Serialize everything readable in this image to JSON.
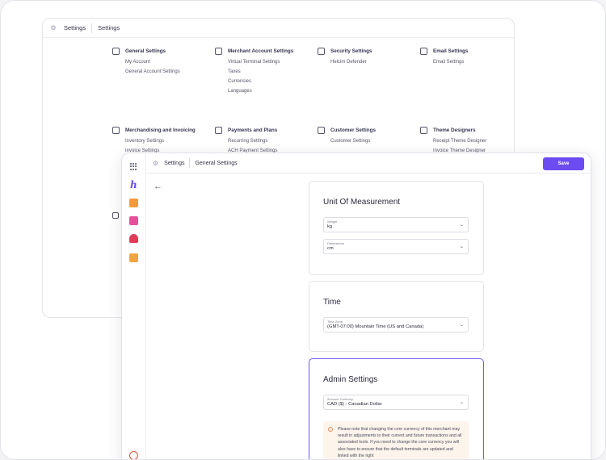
{
  "background_window": {
    "breadcrumb": [
      "Settings",
      "Settings"
    ],
    "categories": [
      {
        "title": "General Settings",
        "icon": "gear-icon",
        "items": [
          "My Account",
          "General Account Settings"
        ]
      },
      {
        "title": "Merchant Account Settings",
        "icon": "store-icon",
        "items": [
          "Virtual Terminal Settings",
          "Taxes",
          "Currencies",
          "Languages"
        ]
      },
      {
        "title": "Security Settings",
        "icon": "user-shield-icon",
        "items": [
          "Helcim Defender"
        ]
      },
      {
        "title": "Email Settings",
        "icon": "email-icon",
        "items": [
          "Email Settings"
        ]
      },
      {
        "title": "Merchandising and Invoicing",
        "icon": "invoice-icon",
        "items": [
          "Inventory Settings",
          "Invoice Settings"
        ]
      },
      {
        "title": "Payments and Plans",
        "icon": "card-icon",
        "items": [
          "Recurring Settings",
          "ACH Payment Settings"
        ]
      },
      {
        "title": "Customer Settings",
        "icon": "person-icon",
        "items": [
          "Customer Settings"
        ]
      },
      {
        "title": "Theme Designers",
        "icon": "palette-icon",
        "items": [
          "Receipt Theme Designer",
          "Invoice Theme Designer"
        ]
      }
    ]
  },
  "foreground_window": {
    "breadcrumb": [
      "Settings",
      "General Settings"
    ],
    "save_label": "Save",
    "cards": {
      "unit": {
        "title": "Unit Of Measurement",
        "weight_label": "Weight",
        "weight_value": "kg",
        "dimensions_label": "Dimensions",
        "dimensions_value": "cm"
      },
      "time": {
        "title": "Time",
        "tz_label": "Time Zone",
        "tz_value": "(GMT-07:00) Mountain Time (US and Canada)"
      },
      "admin": {
        "title": "Admin Settings",
        "currency_label": "Account Currency",
        "currency_value": "CAD ($) - Canadian Dollar",
        "notice_text": "Please note that changing the core currency of this merchant may result in adjustments to their current and future transactions and all associated tools. If you need to change the core currency you will also have to ensure that the default terminals are updated and linked with the right"
      }
    }
  },
  "colors": {
    "accent": "#6c4cf0",
    "notice_bg": "#fdf4ec",
    "notice_icon": "#e0905a"
  }
}
